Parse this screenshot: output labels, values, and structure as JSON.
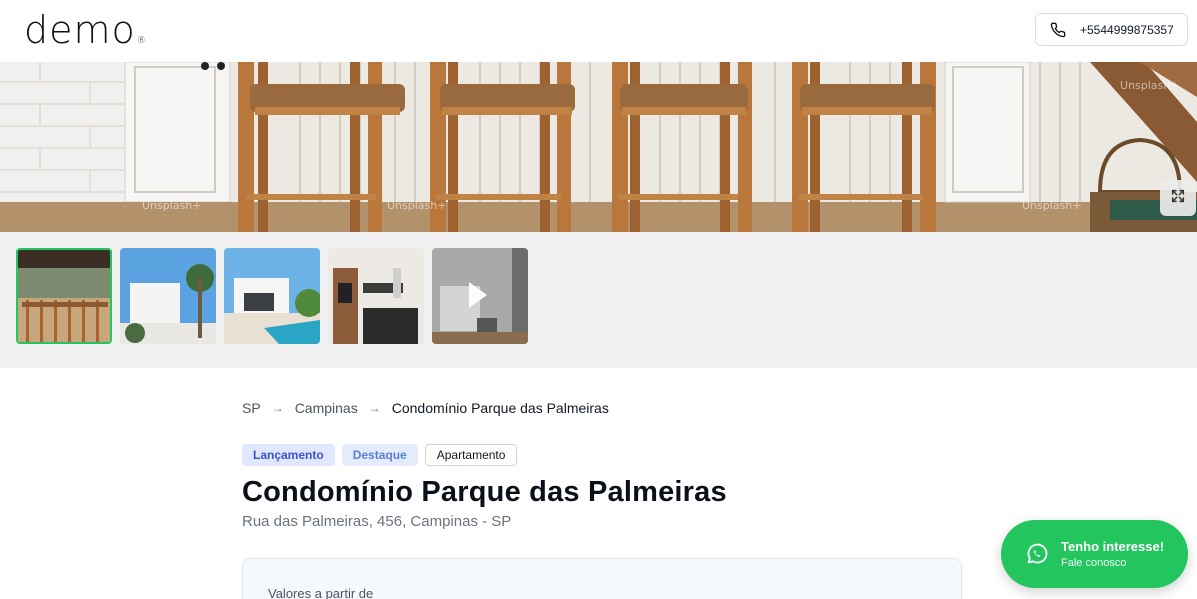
{
  "header": {
    "logo_text": "demo",
    "logo_mark": "®",
    "phone_icon": "phone-icon",
    "phone_number": "+5544999875357"
  },
  "hero": {
    "expand_icon": "expand-icon",
    "watermark": "Unsplash+"
  },
  "thumbnails": [
    {
      "alt": "bar-stools-kitchen"
    },
    {
      "alt": "white-house-palm-trees"
    },
    {
      "alt": "modern-house-pool"
    },
    {
      "alt": "modern-kitchen"
    },
    {
      "alt": "bedroom-video",
      "video": true
    }
  ],
  "breadcrumb": {
    "items": [
      "SP",
      "Campinas",
      "Condomínio Parque das Palmeiras"
    ],
    "separator_icon": "arrow-right-icon"
  },
  "tags": [
    "Lançamento",
    "Destaque",
    "Apartamento"
  ],
  "property": {
    "title": "Condomínio Parque das Palmeiras",
    "address": "Rua das Palmeiras, 456, Campinas - SP"
  },
  "price": {
    "label": "Valores a partir de"
  },
  "cta": {
    "icon": "whatsapp-icon",
    "title": "Tenho interesse!",
    "subtitle": "Fale conosco"
  },
  "colors": {
    "accent_green": "#22c55e",
    "tag_blue": "#3b55c9"
  }
}
